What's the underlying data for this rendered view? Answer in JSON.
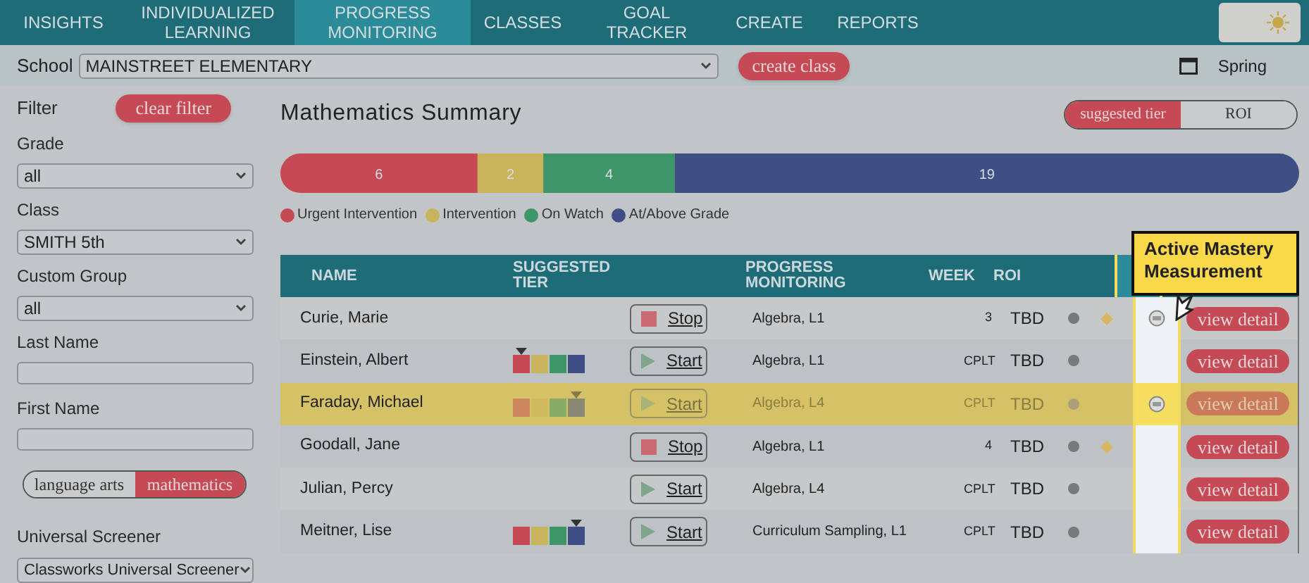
{
  "nav": {
    "tabs": [
      {
        "label": "INSIGHTS",
        "selected": false
      },
      {
        "label": "INDIVIDUALIZED LEARNING",
        "selected": false
      },
      {
        "label": "PROGRESS MONITORING",
        "selected": true
      },
      {
        "label": "CLASSES",
        "selected": false
      },
      {
        "label": "GOAL TRACKER",
        "selected": false
      },
      {
        "label": "CREATE",
        "selected": false
      },
      {
        "label": "REPORTS",
        "selected": false
      }
    ]
  },
  "toolbar": {
    "school_label": "School",
    "school": "MAINSTREET ELEMENTARY",
    "create_button": "create class",
    "term": "Spring"
  },
  "filter": {
    "title": "Filter",
    "clear_button": "clear filter",
    "fields": [
      {
        "kind": "select",
        "label": "Grade",
        "value": "all"
      },
      {
        "kind": "select",
        "label": "Class",
        "value": "SMITH 5th"
      },
      {
        "kind": "select",
        "label": "Custom Group",
        "value": "all"
      },
      {
        "kind": "text",
        "label": "Last Name"
      },
      {
        "kind": "text",
        "label": "First Name"
      }
    ],
    "subjects": [
      {
        "label": "language arts",
        "selected": false
      },
      {
        "label": "mathematics",
        "selected": true
      }
    ],
    "screener_label": "Universal Screener",
    "screener": "Classworks Universal Screener"
  },
  "summary": {
    "title": "Mathematics Summary",
    "view_toggle": [
      {
        "label": "suggested tier",
        "selected": true
      },
      {
        "label": "ROI",
        "selected": false
      }
    ],
    "chart_data": {
      "type": "bar",
      "orientation": "horizontal",
      "stacked": true,
      "data_labels": true,
      "legend": "bottom",
      "series": [
        {
          "name": "Urgent Intervention",
          "color": "#c64a55",
          "values": [
            6
          ]
        },
        {
          "name": "Intervention",
          "color": "#c8b45a",
          "values": [
            2
          ]
        },
        {
          "name": "On Watch",
          "color": "#3e9568",
          "values": [
            4
          ]
        },
        {
          "name": "At/Above Grade",
          "color": "#3f4f85",
          "values": [
            19
          ]
        }
      ]
    }
  },
  "table": {
    "columns": [
      "NAME",
      "SUGGESTED TIER",
      "PROGRESS MONITORING",
      "WEEK",
      "ROI"
    ],
    "rows": [
      {
        "name": "Curie, Marie",
        "tier": {
          "kind": "none"
        },
        "action": {
          "kind": "stop",
          "label": "Stop"
        },
        "pm": "Algebra, L1",
        "week": "3",
        "roi": "TBD",
        "diamond": true,
        "mastery": true,
        "selected": false,
        "detail": "view detail"
      },
      {
        "name": "Einstein, Albert",
        "tier": {
          "kind": "urgent"
        },
        "action": {
          "kind": "start",
          "label": "Start"
        },
        "pm": "Algebra, L1",
        "week": "CPLT",
        "roi": "TBD",
        "diamond": false,
        "mastery": false,
        "selected": false,
        "detail": "view detail"
      },
      {
        "name": "Faraday, Michael",
        "tier": {
          "kind": "at_above"
        },
        "action": {
          "kind": "start",
          "label": "Start"
        },
        "pm": "Algebra, L4",
        "week": "CPLT",
        "roi": "TBD",
        "diamond": false,
        "mastery": true,
        "selected": true,
        "detail": "view detail"
      },
      {
        "name": "Goodall, Jane",
        "tier": {
          "kind": "none"
        },
        "action": {
          "kind": "stop",
          "label": "Stop"
        },
        "pm": "Algebra, L1",
        "week": "4",
        "roi": "TBD",
        "diamond": true,
        "mastery": false,
        "selected": false,
        "detail": "view detail"
      },
      {
        "name": "Julian, Percy",
        "tier": {
          "kind": "none"
        },
        "action": {
          "kind": "start",
          "label": "Start"
        },
        "pm": "Algebra, L4",
        "week": "CPLT",
        "roi": "TBD",
        "diamond": false,
        "mastery": false,
        "selected": false,
        "detail": "view detail"
      },
      {
        "name": "Meitner, Lise",
        "tier": {
          "kind": "at_above"
        },
        "action": {
          "kind": "start",
          "label": "Start"
        },
        "pm": "Curriculum Sampling, L1",
        "week": "CPLT",
        "roi": "TBD",
        "diamond": false,
        "mastery": false,
        "selected": false,
        "detail": "view detail"
      }
    ]
  },
  "callout": "Active Mastery Measurement"
}
